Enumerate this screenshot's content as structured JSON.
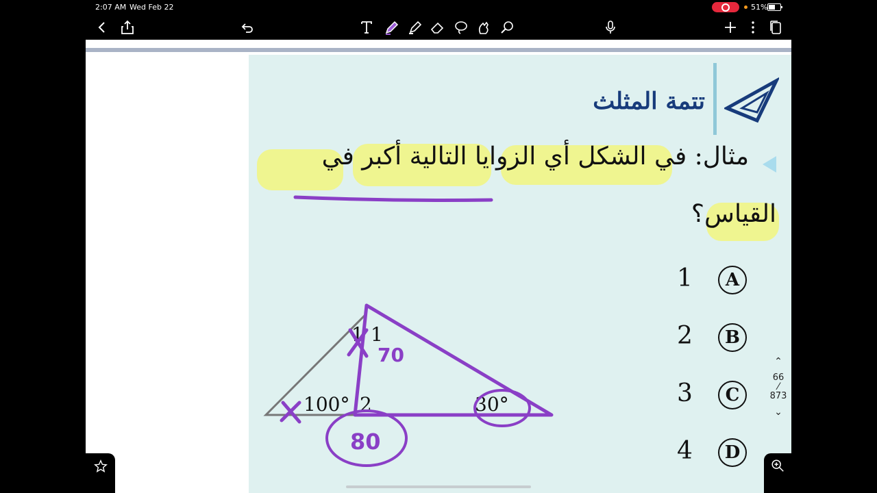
{
  "status": {
    "time": "2:07 AM",
    "date": "Wed Feb 22",
    "battery": "51%"
  },
  "toolbar": {
    "icons": [
      "back-chevron-icon",
      "share-icon",
      "undo-icon",
      "text-tool-icon",
      "pen-tool-icon",
      "highlighter-tool-icon",
      "eraser-tool-icon",
      "lasso-tool-icon",
      "image-tool-icon",
      "laser-pointer-icon",
      "microphone-icon",
      "add-icon",
      "more-icon",
      "pages-icon"
    ]
  },
  "document": {
    "title": "تتمة المثلث",
    "question_line1": "مثال: في الشكل أي الزوايا التالية أكبر في",
    "question_line2": "القياس؟",
    "choices": [
      {
        "number": "1",
        "letter": "A"
      },
      {
        "number": "2",
        "letter": "B"
      },
      {
        "number": "3",
        "letter": "C"
      },
      {
        "number": "4",
        "letter": "D"
      }
    ],
    "figure": {
      "angle_1": "1",
      "angle_100": "100°",
      "angle_2": "2",
      "angle_30": "30°",
      "angle_unlabeled": "1",
      "handwritten_70": "70",
      "handwritten_80": "80"
    }
  },
  "pager": {
    "current": "66",
    "total": "873"
  },
  "colors": {
    "ink_purple": "#8a3fc6",
    "highlight": "#f2f67f",
    "page_bg": "#dff1f0",
    "title_blue": "#173b7b"
  }
}
